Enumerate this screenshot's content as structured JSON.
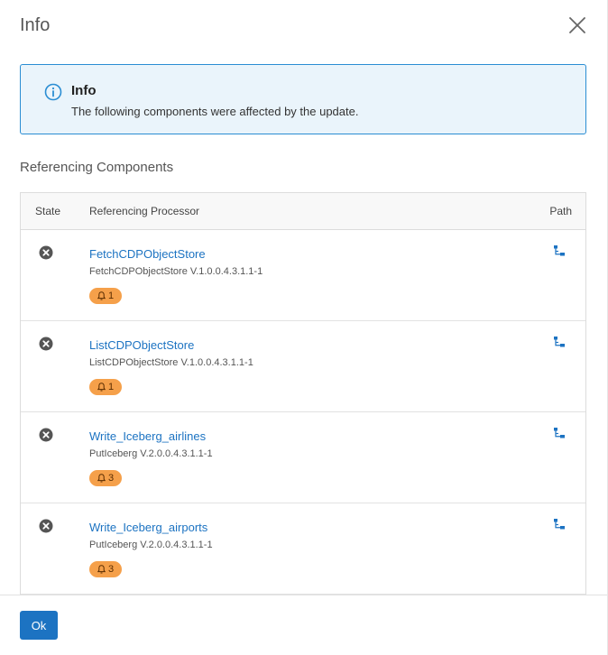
{
  "dialog": {
    "title": "Info"
  },
  "alert": {
    "title": "Info",
    "message": "The following components were affected by the update."
  },
  "section": {
    "title": "Referencing Components"
  },
  "table": {
    "headers": {
      "state": "State",
      "processor": "Referencing Processor",
      "path": "Path"
    },
    "rows": [
      {
        "name": "FetchCDPObjectStore",
        "version": "FetchCDPObjectStore V.1.0.0.4.3.1.1-1",
        "bulletins": "1",
        "state_icon": "stopped-icon"
      },
      {
        "name": "ListCDPObjectStore",
        "version": "ListCDPObjectStore V.1.0.0.4.3.1.1-1",
        "bulletins": "1",
        "state_icon": "stopped-icon"
      },
      {
        "name": "Write_Iceberg_airlines",
        "version": "PutIceberg V.2.0.0.4.3.1.1-1",
        "bulletins": "3",
        "state_icon": "stopped-icon"
      },
      {
        "name": "Write_Iceberg_airports",
        "version": "PutIceberg V.2.0.0.4.3.1.1-1",
        "bulletins": "3",
        "state_icon": "stopped-icon"
      }
    ]
  },
  "footer": {
    "ok_label": "Ok"
  },
  "colors": {
    "accent": "#1c73c2",
    "alert_border": "#2a8dd3",
    "alert_bg": "#eaf4fb",
    "badge": "#f5a04a"
  }
}
